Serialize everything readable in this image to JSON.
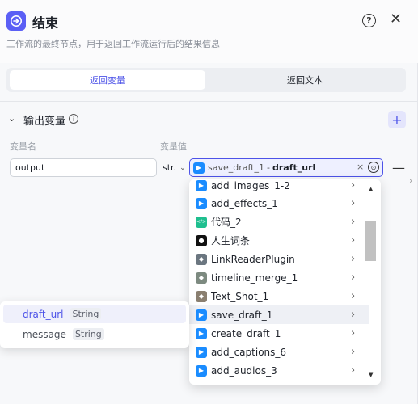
{
  "header": {
    "title": "结束",
    "subtitle": "工作流的最终节点，用于返回工作流运行后的结果信息",
    "help": "?",
    "close": "✕"
  },
  "tabs": [
    {
      "label": "返回变量",
      "active": true
    },
    {
      "label": "返回文本",
      "active": false
    }
  ],
  "section": {
    "title": "输出变量",
    "info": "i",
    "add": "+",
    "collapse": "⌄"
  },
  "columns": {
    "name_label": "变量名",
    "value_label": "变量值"
  },
  "row": {
    "name": "output",
    "type": "str.",
    "type_chevron": "⌄",
    "value_node": "save_draft_1",
    "value_sep": "-",
    "value_field": "draft_url",
    "clear": "×",
    "target": "⊙",
    "remove": "—"
  },
  "dropdown": {
    "items": [
      {
        "label": "add_images_1-2",
        "icon": "play-icon",
        "color": "#1a8cff"
      },
      {
        "label": "add_effects_1",
        "icon": "play-icon",
        "color": "#1a8cff"
      },
      {
        "label": "代码_2",
        "icon": "code-icon",
        "color": "#1fbf8f"
      },
      {
        "label": "人生词条",
        "icon": "plugin-icon",
        "color": "#111111"
      },
      {
        "label": "LinkReaderPlugin",
        "icon": "photo-icon",
        "color": "#6b7680"
      },
      {
        "label": "timeline_merge_1",
        "icon": "photo-icon",
        "color": "#7d8a80"
      },
      {
        "label": "Text_Shot_1",
        "icon": "photo-icon",
        "color": "#8a7f70"
      },
      {
        "label": "save_draft_1",
        "icon": "play-icon",
        "color": "#1a8cff"
      },
      {
        "label": "create_draft_1",
        "icon": "play-icon",
        "color": "#1a8cff"
      },
      {
        "label": "add_captions_6",
        "icon": "play-icon",
        "color": "#1a8cff"
      },
      {
        "label": "add_audios_3",
        "icon": "play-icon",
        "color": "#1a8cff"
      }
    ],
    "chevron": "›",
    "scroll_up": "▲",
    "scroll_down": "▼"
  },
  "popup": {
    "items": [
      {
        "name": "draft_url",
        "type": "String"
      },
      {
        "name": "message",
        "type": "String"
      }
    ]
  },
  "colors": {
    "accent": "#4d53e8",
    "node_icon": "#1a8cff"
  }
}
